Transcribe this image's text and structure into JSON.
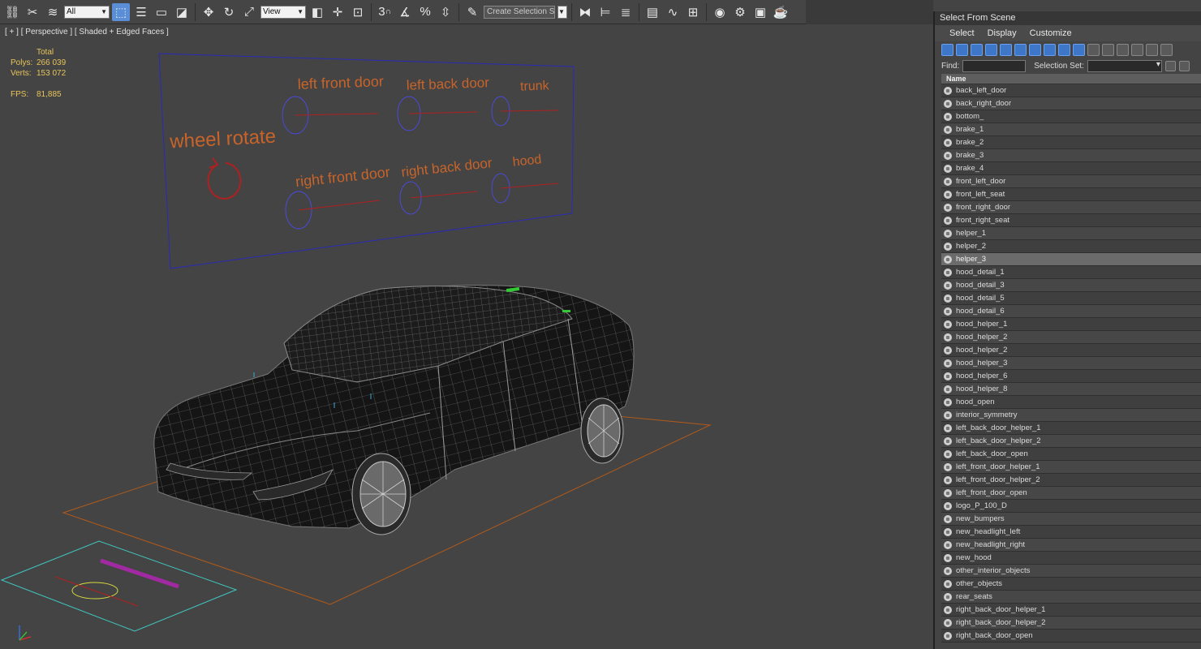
{
  "toolbar": {
    "filter_value": "All",
    "coord_value": "View",
    "selection_set_placeholder": "Create Selection Se",
    "snap_label": "3"
  },
  "viewport": {
    "label": "[ + ] [ Perspective ] [ Shaded + Edged Faces ]",
    "stats": {
      "total_label": "Total",
      "polys_label": "Polys:",
      "polys_value": "266 039",
      "verts_label": "Verts:",
      "verts_value": "153 072",
      "fps_label": "FPS:",
      "fps_value": "81,885"
    },
    "controls": {
      "wheel_rotate": "wheel rotate",
      "left_front_door": "left front door",
      "left_back_door": "left back door",
      "trunk": "trunk",
      "right_front_door": "right front door",
      "right_back_door": "right back door",
      "hood": "hood"
    },
    "colors": {
      "text_orange": "#c8642a",
      "circle_blue": "#4a4ad8",
      "line_red": "#b02020",
      "frame_blue": "#2a2ab8",
      "ground_orange": "#b05a1a",
      "helper_cyan": "#40c8c0",
      "helper_yellow": "#d8d840",
      "helper_magenta": "#c020c0"
    }
  },
  "panel": {
    "title": "Select From Scene",
    "menu": [
      "Select",
      "Display",
      "Customize"
    ],
    "find_label": "Find:",
    "selection_set_label": "Selection Set:",
    "column_name": "Name",
    "selected_item": "helper_3",
    "items": [
      "back_left_door",
      "back_right_door",
      "bottom_",
      "brake_1",
      "brake_2",
      "brake_3",
      "brake_4",
      "front_left_door",
      "front_left_seat",
      "front_right_door",
      "front_right_seat",
      "helper_1",
      "helper_2",
      "helper_3",
      "hood_detail_1",
      "hood_detail_3",
      "hood_detail_5",
      "hood_detail_6",
      "hood_helper_1",
      "hood_helper_2",
      "hood_helper_2",
      "hood_helper_3",
      "hood_helper_6",
      "hood_helper_8",
      "hood_open",
      "interior_symmetry",
      "left_back_door_helper_1",
      "left_back_door_helper_2",
      "left_back_door_open",
      "left_front_door_helper_1",
      "left_front_door_helper_2",
      "left_front_door_open",
      "logo_P_100_D",
      "new_bumpers",
      "new_headlight_left",
      "new_headlight_right",
      "new_hood",
      "other_interior_objects",
      "other_objects",
      "rear_seats",
      "right_back_door_helper_1",
      "right_back_door_helper_2",
      "right_back_door_open"
    ]
  }
}
